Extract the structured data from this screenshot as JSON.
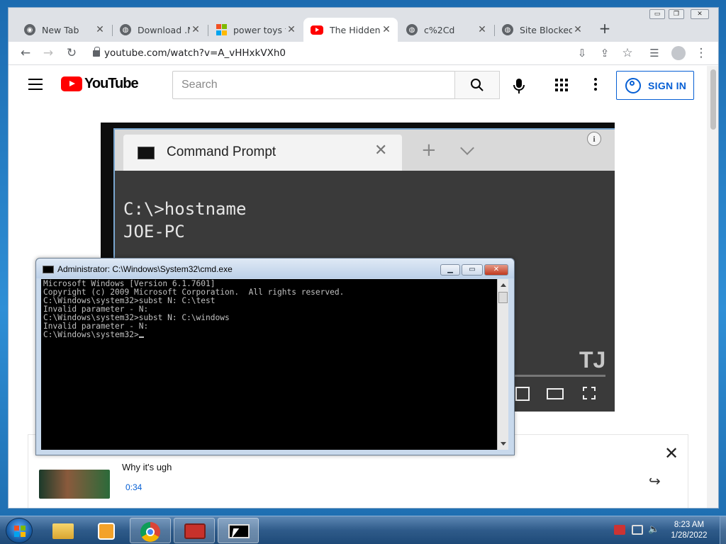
{
  "browser": {
    "tabs": [
      {
        "title": "New Tab",
        "active": false
      },
      {
        "title": "Download .N",
        "active": false
      },
      {
        "title": "power toys fo",
        "active": false
      },
      {
        "title": "The Hidden",
        "active": true
      },
      {
        "title": "c%2Cd",
        "active": false
      },
      {
        "title": "Site Blocked",
        "active": false
      }
    ],
    "url": "youtube.com/watch?v=A_vHHxkVXh0",
    "window_controls": {
      "minimize": "▭",
      "restore": "❐",
      "close": "✕"
    }
  },
  "youtube": {
    "logo_text": "YouTube",
    "search_placeholder": "Search",
    "signin_label": "SIGN IN",
    "video": {
      "inner_tab_title": "Command Prompt",
      "inner_lines": [
        "C:\\>hostname",
        "JOE-PC"
      ],
      "watermark": "TJ"
    },
    "below": {
      "item_title": "Why it's ugh",
      "duration": "0:34"
    }
  },
  "cmd": {
    "title": "Administrator: C:\\Windows\\System32\\cmd.exe",
    "lines": [
      "Microsoft Windows [Version 6.1.7601]",
      "Copyright (c) 2009 Microsoft Corporation.  All rights reserved.",
      "",
      "C:\\Windows\\system32>subst N: C:\\test",
      "Invalid parameter - N:",
      "",
      "C:\\Windows\\system32>subst N: C:\\windows",
      "Invalid parameter - N:",
      ""
    ],
    "prompt": "C:\\Windows\\system32>"
  },
  "taskbar": {
    "items": [
      {
        "name": "windows-explorer",
        "active": false
      },
      {
        "name": "media-player",
        "active": false
      },
      {
        "name": "google-chrome",
        "active": false
      },
      {
        "name": "toolbox-app",
        "active": false
      },
      {
        "name": "cmd",
        "active": true
      }
    ],
    "time": "8:23 AM",
    "date": "1/28/2022"
  },
  "colors": {
    "youtube_red": "#ff0000",
    "youtube_blue": "#065fd4",
    "taskbar": "#2f5b8a"
  }
}
